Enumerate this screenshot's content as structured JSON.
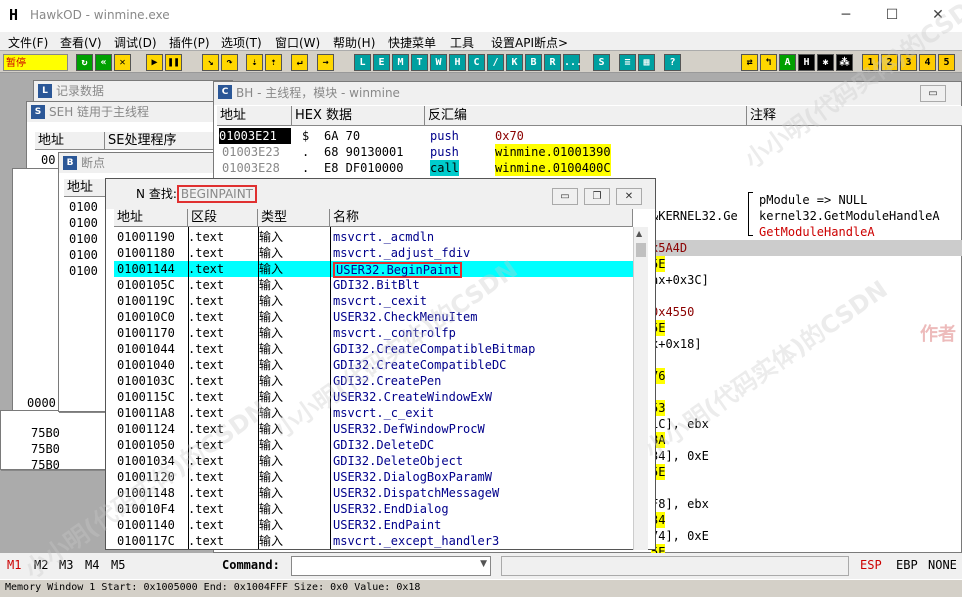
{
  "app": {
    "title": "HawkOD",
    "subtitle": "- winmine.exe"
  },
  "menu": [
    "文件(F)",
    "查看(V)",
    "调试(D)",
    "插件(P)",
    "选项(T)",
    "窗口(W)",
    "帮助(H)",
    "快捷菜单",
    "工具",
    "设置API断点>"
  ],
  "toolbar": {
    "status": "暂停",
    "letters": [
      "L",
      "E",
      "M",
      "T",
      "W",
      "H",
      "C",
      "/",
      "K",
      "B",
      "R",
      "...",
      "S"
    ],
    "right_nums": [
      "1",
      "2",
      "3",
      "4",
      "5"
    ]
  },
  "windows": {
    "log": {
      "title": "记录数据"
    },
    "seh": {
      "title": "SEH 链用于主线程",
      "col1": "地址",
      "col2": "SE处理程序",
      "rows": [
        "00",
        "00"
      ]
    },
    "bp": {
      "title": "断点",
      "col1": "地址",
      "rows": [
        "0100",
        "0100",
        "0100",
        "0100",
        "0100"
      ]
    },
    "mem_rows": [
      "0000",
      "75B0",
      "75B0",
      "75B0"
    ],
    "cpu": {
      "title": "BH - 主线程，模块 - winmine",
      "cols": {
        "addr": "地址",
        "hex": "HEX 数据",
        "disasm": "反汇编",
        "comment": "注释"
      },
      "rows": [
        {
          "addr": "01003E21",
          "mark": "$",
          "hex": "6A 70",
          "mnem": "push",
          "op": "0x70"
        },
        {
          "addr": "01003E23",
          "mark": ".",
          "hex": "68 90130001",
          "mnem": "push",
          "op": "winmine.01001390"
        },
        {
          "addr": "01003E28",
          "mark": ".",
          "hex": "E8 DF010000",
          "mnem": "call",
          "op": "winmine.0100400C"
        }
      ],
      "comments": [
        "pModule => NULL",
        "kernel32.GetModuleHandleA",
        "GetModuleHandleA"
      ],
      "right_frags": [
        "&KERNEL32.Ge",
        "x5A4D",
        "5E",
        "ax+0x3C]",
        "0x4550",
        "5E",
        "x+0x18]",
        "76",
        "53",
        "1C], ebx",
        "8A",
        "34], 0xE",
        "5E",
        "F8], ebx",
        "34",
        "74], 0xE",
        "5E"
      ]
    },
    "names": {
      "title_prefix": "查找:",
      "title_query": "BEGINPAINT",
      "cols": {
        "addr": "地址",
        "sec": "区段",
        "type": "类型",
        "name": "名称"
      },
      "rows": [
        {
          "addr": "01001190",
          "sec": ".text",
          "type": "输入",
          "name": "msvcrt._acmdln"
        },
        {
          "addr": "01001180",
          "sec": ".text",
          "type": "输入",
          "name": "msvcrt._adjust_fdiv"
        },
        {
          "addr": "01001144",
          "sec": ".text",
          "type": "输入",
          "name": "USER32.BeginPaint"
        },
        {
          "addr": "0100105C",
          "sec": ".text",
          "type": "输入",
          "name": "GDI32.BitBlt"
        },
        {
          "addr": "0100119C",
          "sec": ".text",
          "type": "输入",
          "name": "msvcrt._cexit"
        },
        {
          "addr": "010010C0",
          "sec": ".text",
          "type": "输入",
          "name": "USER32.CheckMenuItem"
        },
        {
          "addr": "01001170",
          "sec": ".text",
          "type": "输入",
          "name": "msvcrt._controlfp"
        },
        {
          "addr": "01001044",
          "sec": ".text",
          "type": "输入",
          "name": "GDI32.CreateCompatibleBitmap"
        },
        {
          "addr": "01001040",
          "sec": ".text",
          "type": "输入",
          "name": "GDI32.CreateCompatibleDC"
        },
        {
          "addr": "0100103C",
          "sec": ".text",
          "type": "输入",
          "name": "GDI32.CreatePen"
        },
        {
          "addr": "0100115C",
          "sec": ".text",
          "type": "输入",
          "name": "USER32.CreateWindowExW"
        },
        {
          "addr": "010011A8",
          "sec": ".text",
          "type": "输入",
          "name": "msvcrt._c_exit"
        },
        {
          "addr": "01001124",
          "sec": ".text",
          "type": "输入",
          "name": "USER32.DefWindowProcW"
        },
        {
          "addr": "01001050",
          "sec": ".text",
          "type": "输入",
          "name": "GDI32.DeleteDC"
        },
        {
          "addr": "01001034",
          "sec": ".text",
          "type": "输入",
          "name": "GDI32.DeleteObject"
        },
        {
          "addr": "01001120",
          "sec": ".text",
          "type": "输入",
          "name": "USER32.DialogBoxParamW"
        },
        {
          "addr": "01001148",
          "sec": ".text",
          "type": "输入",
          "name": "USER32.DispatchMessageW"
        },
        {
          "addr": "010010F4",
          "sec": ".text",
          "type": "输入",
          "name": "USER32.EndDialog"
        },
        {
          "addr": "01001140",
          "sec": ".text",
          "type": "输入",
          "name": "USER32.EndPaint"
        },
        {
          "addr": "0100117C",
          "sec": ".text",
          "type": "输入",
          "name": "msvcrt._except_handler3"
        }
      ]
    }
  },
  "bottom": {
    "m_tabs": [
      "M1",
      "M2",
      "M3",
      "M4",
      "M5"
    ],
    "command_label": "Command:",
    "regs": [
      "ESP",
      "EBP",
      "NONE"
    ]
  },
  "mem_status": "Memory Window 1  Start: 0x1005000  End: 0x1004FFF  Size: 0x0 Value: 0x18",
  "watermark": "小小明(代码实体)的CSDN",
  "watermark2": "作者"
}
